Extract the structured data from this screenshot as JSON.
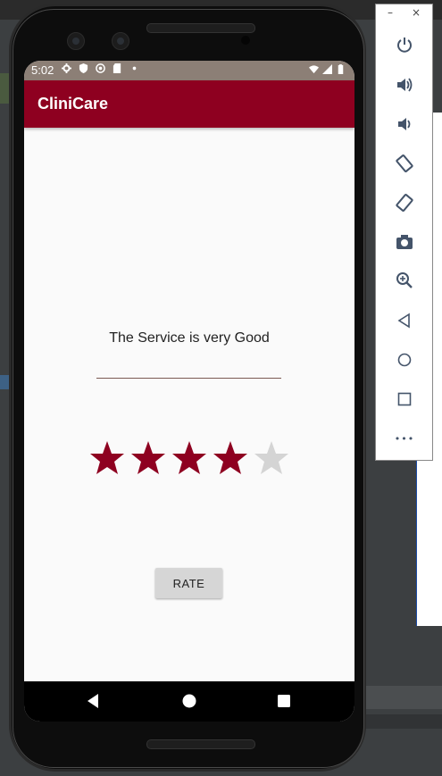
{
  "app": {
    "title": "CliniCare"
  },
  "status_bar": {
    "time": "5:02"
  },
  "main": {
    "message": "The Service is very Good",
    "rating": {
      "value": 4,
      "max": 5,
      "filled_color": "#8e0020",
      "empty_color": "#d4d4d4"
    },
    "rate_button_label": "RATE"
  },
  "nav_bar": {
    "buttons": [
      "back-icon",
      "home-icon",
      "recents-icon"
    ]
  },
  "emulator_panel": {
    "window_controls": {
      "minimize": "–",
      "close": "×"
    },
    "tools": [
      "power-icon",
      "volume-up-icon",
      "volume-down-icon",
      "rotate-left-icon",
      "rotate-right-icon",
      "screenshot-icon",
      "zoom-icon",
      "back-icon",
      "home-icon",
      "overview-icon",
      "more-icon"
    ],
    "more_glyph": "•••"
  },
  "colors": {
    "app_bar": "#8e0020",
    "status_bar": "#8c7f76",
    "background": "#fafafa"
  }
}
